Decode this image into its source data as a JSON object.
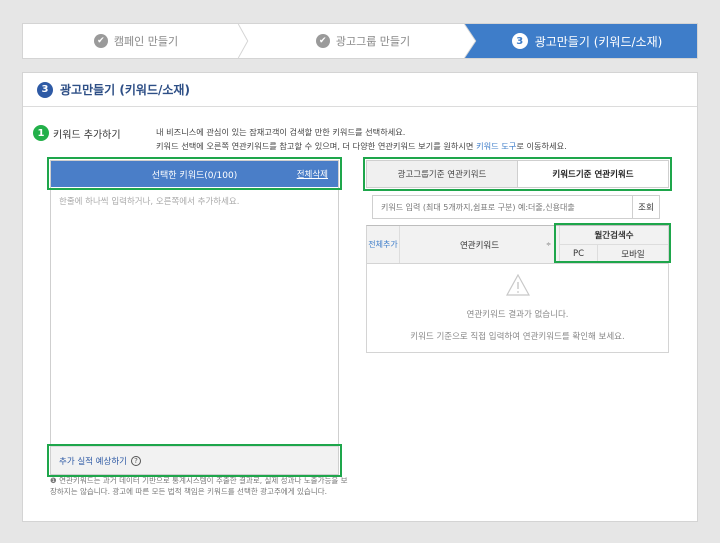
{
  "stepper": {
    "step1": "캠페인 만들기",
    "step2": "광고그룹 만들기",
    "step3_num": "3",
    "step3": "광고만들기 (키워드/소재)"
  },
  "section": {
    "num": "3",
    "title": "광고만들기 (키워드/소재)"
  },
  "keyword_add": {
    "num": "1",
    "label": "키워드 추가하기",
    "desc_line1": "내 비즈니스에 관심이 있는 잠재고객이 검색할 만한 키워드를 선택하세요.",
    "desc_line2": "키워드 선택에 오른쪽 연관키워드를 참고할 수 있으며, 더 다양한 연관키워드 보기를 원하시면",
    "desc_link": "키워드 도구",
    "desc_tail": "로 이동하세요."
  },
  "left": {
    "header": "선택한 키워드(0/100)",
    "delete_all": "전체삭제",
    "hint": "한줄에 하나씩 입력하거나, 오른쪽에서 추가하세요.",
    "estimate": "추가 실적 예상하기",
    "estimate_icon": "?"
  },
  "note": "연관키워드는 과거 데이터 기반으로 통계시스템이 추출한 결과로, 실제 성과나 노출가능을 보장하지는 않습니다. 광고에 따른 모든 법적 책임은 키워드를 선택한 광고주에게 있습니다.",
  "right": {
    "tab1": "광고그룹기준 연관키워드",
    "tab2": "키워드기준 연관키워드",
    "search_placeholder": "키워드 입력 (최대 5개까지,쉼표로 구분) 예:더줄,신용대출",
    "search_button": "조회",
    "col_add": "전체추가",
    "col_keyword": "연관키워드",
    "sort_icon": "≑",
    "col_monthly": "월간검색수",
    "col_pc": "PC",
    "col_mobile": "모바일",
    "empty1": "연관키워드 결과가 없습니다.",
    "empty2": "키워드 기준으로 직접 입력하여 연관키워드를 확인해 보세요."
  }
}
